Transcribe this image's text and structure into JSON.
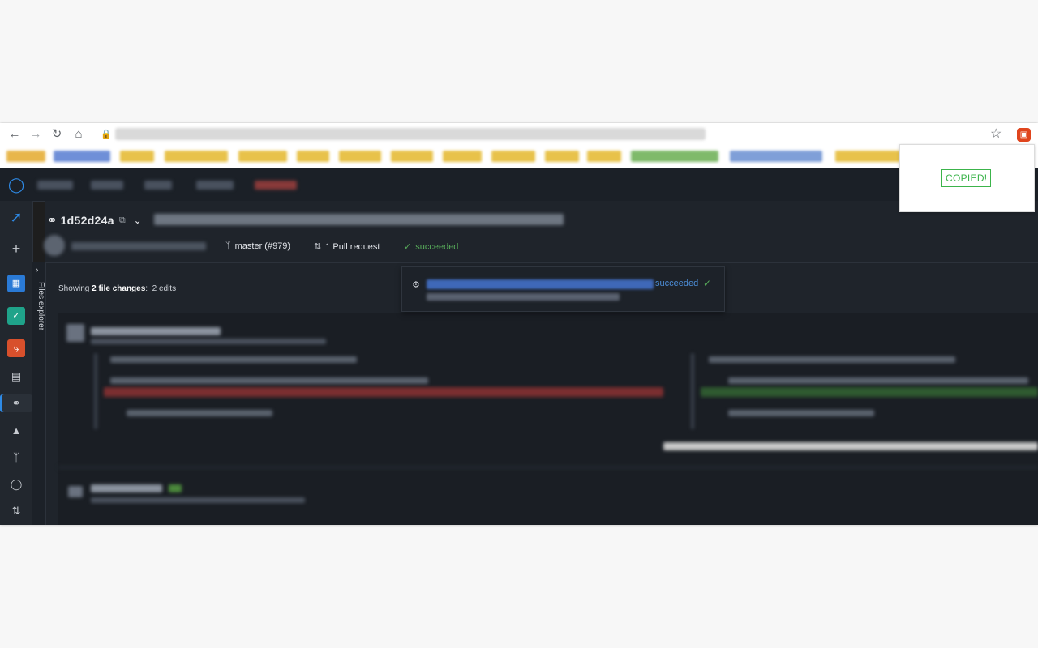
{
  "commit": {
    "id": "1d52d24a"
  },
  "meta": {
    "branch": "master (#979)",
    "pull_requests": "1 Pull request",
    "status": "succeeded"
  },
  "files": {
    "explorer_label": "Files explorer",
    "showing_prefix": "Showing",
    "showing_count": "2 file changes",
    "showing_suffix": ":",
    "edits": "2 edits"
  },
  "pipeline_popup": {
    "status": "succeeded"
  },
  "extension_popup": {
    "message": "COPIED!"
  },
  "colors": {
    "accent": "#2e8ae6",
    "success": "#57ab5a",
    "link": "#4c8ed9",
    "copied": "#3cb44b",
    "extension": "#e0451d"
  },
  "icons": {
    "back": "arrow-left-icon",
    "forward": "arrow-right-icon",
    "reload": "reload-icon",
    "home": "home-icon",
    "lock": "lock-icon",
    "bookmark": "star-icon",
    "extension": "extension-icon",
    "commit": "commit-icon",
    "copy": "copy-icon",
    "branch": "branch-icon",
    "pull_request": "pull-request-icon",
    "check": "check-icon",
    "pipeline": "pipeline-icon"
  }
}
